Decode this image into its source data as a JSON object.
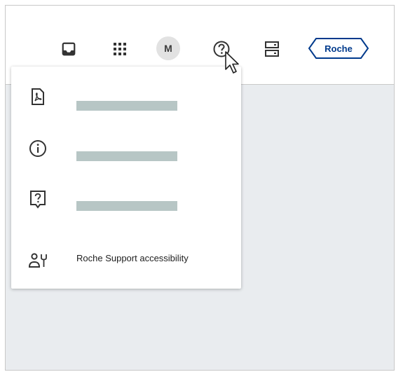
{
  "header": {
    "avatar_initial": "M",
    "logo_text": "Roche",
    "icons": [
      "inbox-icon",
      "apps-grid-icon",
      "avatar",
      "help-icon",
      "server-icon",
      "roche-logo"
    ]
  },
  "help_menu": {
    "items": [
      {
        "icon": "pdf-document-icon",
        "label": ""
      },
      {
        "icon": "info-icon",
        "label": ""
      },
      {
        "icon": "help-chat-icon",
        "label": ""
      },
      {
        "icon": "support-accessibility-icon",
        "label": "Roche Support accessibility"
      }
    ]
  },
  "colors": {
    "accent": "#003a8c",
    "redaction": "#b7c6c5",
    "background": "#e9ecef"
  }
}
